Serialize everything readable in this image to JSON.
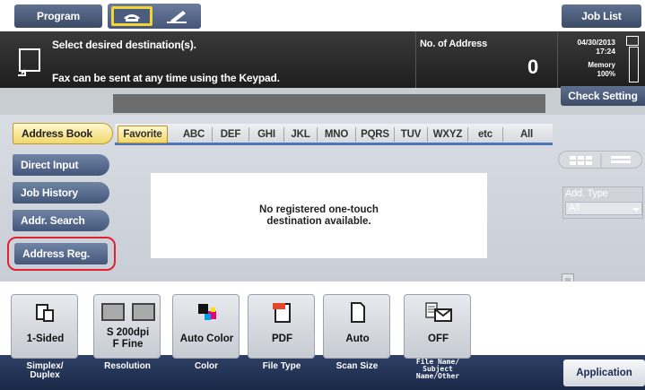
{
  "topbar": {
    "program_label": "Program",
    "joblist_label": "Job List"
  },
  "header": {
    "message1": "Select desired destination(s).",
    "message2": "Fax can be sent at any time using the Keypad.",
    "no_of_address_label": "No. of Address",
    "no_of_address_value": "0",
    "date": "04/30/2013",
    "time": "17:24",
    "memory_label": "Memory",
    "memory_value": "100%",
    "check_setting_label": "Check Setting"
  },
  "sidebar": {
    "items": [
      {
        "label": "Address Book",
        "selected": true
      },
      {
        "label": "Direct Input"
      },
      {
        "label": "Job History"
      },
      {
        "label": "Addr. Search"
      },
      {
        "label": "Address Reg.",
        "highlighted": true
      }
    ]
  },
  "index_tabs": [
    "Favorite",
    "ABC",
    "DEF",
    "GHI",
    "JKL",
    "MNO",
    "PQRS",
    "TUV",
    "WXYZ",
    "etc",
    "All"
  ],
  "main": {
    "empty_message_line1": "No registered one-touch",
    "empty_message_line2": "destination available."
  },
  "right_panel": {
    "add_type_label": "Add. Type",
    "add_type_value": "All"
  },
  "settings": [
    {
      "value": "1-Sided",
      "label": "Simplex/\nDuplex",
      "icon": "simplex-icon"
    },
    {
      "value": "S 200dpi\nF Fine",
      "label": "Resolution",
      "icon": "resolution-icon"
    },
    {
      "value": "Auto Color",
      "label": "Color",
      "icon": "color-icon"
    },
    {
      "value": "PDF",
      "label": "File Type",
      "icon": "pdf-icon"
    },
    {
      "value": "Auto",
      "label": "Scan Size",
      "icon": "page-icon"
    },
    {
      "value": "OFF",
      "label": "File Name/\nSubject\nName/Other",
      "icon": "mail-icon"
    }
  ],
  "application_label": "Application",
  "colors": {
    "accent_yellow": "#f3d531",
    "highlight_red": "#e02230",
    "navy": "#1b2948"
  }
}
